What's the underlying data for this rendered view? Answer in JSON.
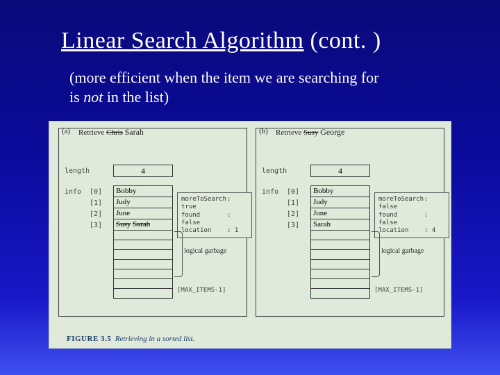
{
  "title": {
    "main": "Linear Search Algorithm",
    "cont": " (cont. )"
  },
  "subtitle": {
    "pre": "(more efficient when the item we are searching for is ",
    "em": "not",
    "post": " in the list)"
  },
  "figure": {
    "caption_fig": "FIGURE 3.5",
    "caption_txt": "Retrieving in a sorted list.",
    "length_value": "4",
    "info_label": "info",
    "length_label": "length",
    "idx": [
      "[0]",
      "[1]",
      "[2]",
      "[3]"
    ],
    "max_items": "[MAX_ITEMS-1]",
    "garbage": "logical\ngarbage",
    "panes": {
      "a": {
        "tag": "(a)",
        "retrieve_prefix": "Retrieve ",
        "retrieve_strike": "Chris",
        "retrieve_hand": "Sarah",
        "names": {
          "0": "Bobby",
          "1": "Judy",
          "2": "June",
          "3_strike": "Susy",
          "3_hand": "Sarah"
        },
        "status": {
          "k1": "moreToSearch",
          "v1": ": true",
          "k2": "found",
          "v2": ": false",
          "k3": "location",
          "v3": ": 1"
        }
      },
      "b": {
        "tag": "(b)",
        "retrieve_prefix": "Retrieve ",
        "retrieve_strike": "Susy",
        "retrieve_hand": "George",
        "names": {
          "0": "Bobby",
          "1": "Judy",
          "2": "June",
          "3": "Sarah"
        },
        "status": {
          "k1": "moreToSearch",
          "v1": ": false",
          "k2": "found",
          "v2": ": false",
          "k3": "location",
          "v3": ": 4"
        }
      }
    }
  }
}
